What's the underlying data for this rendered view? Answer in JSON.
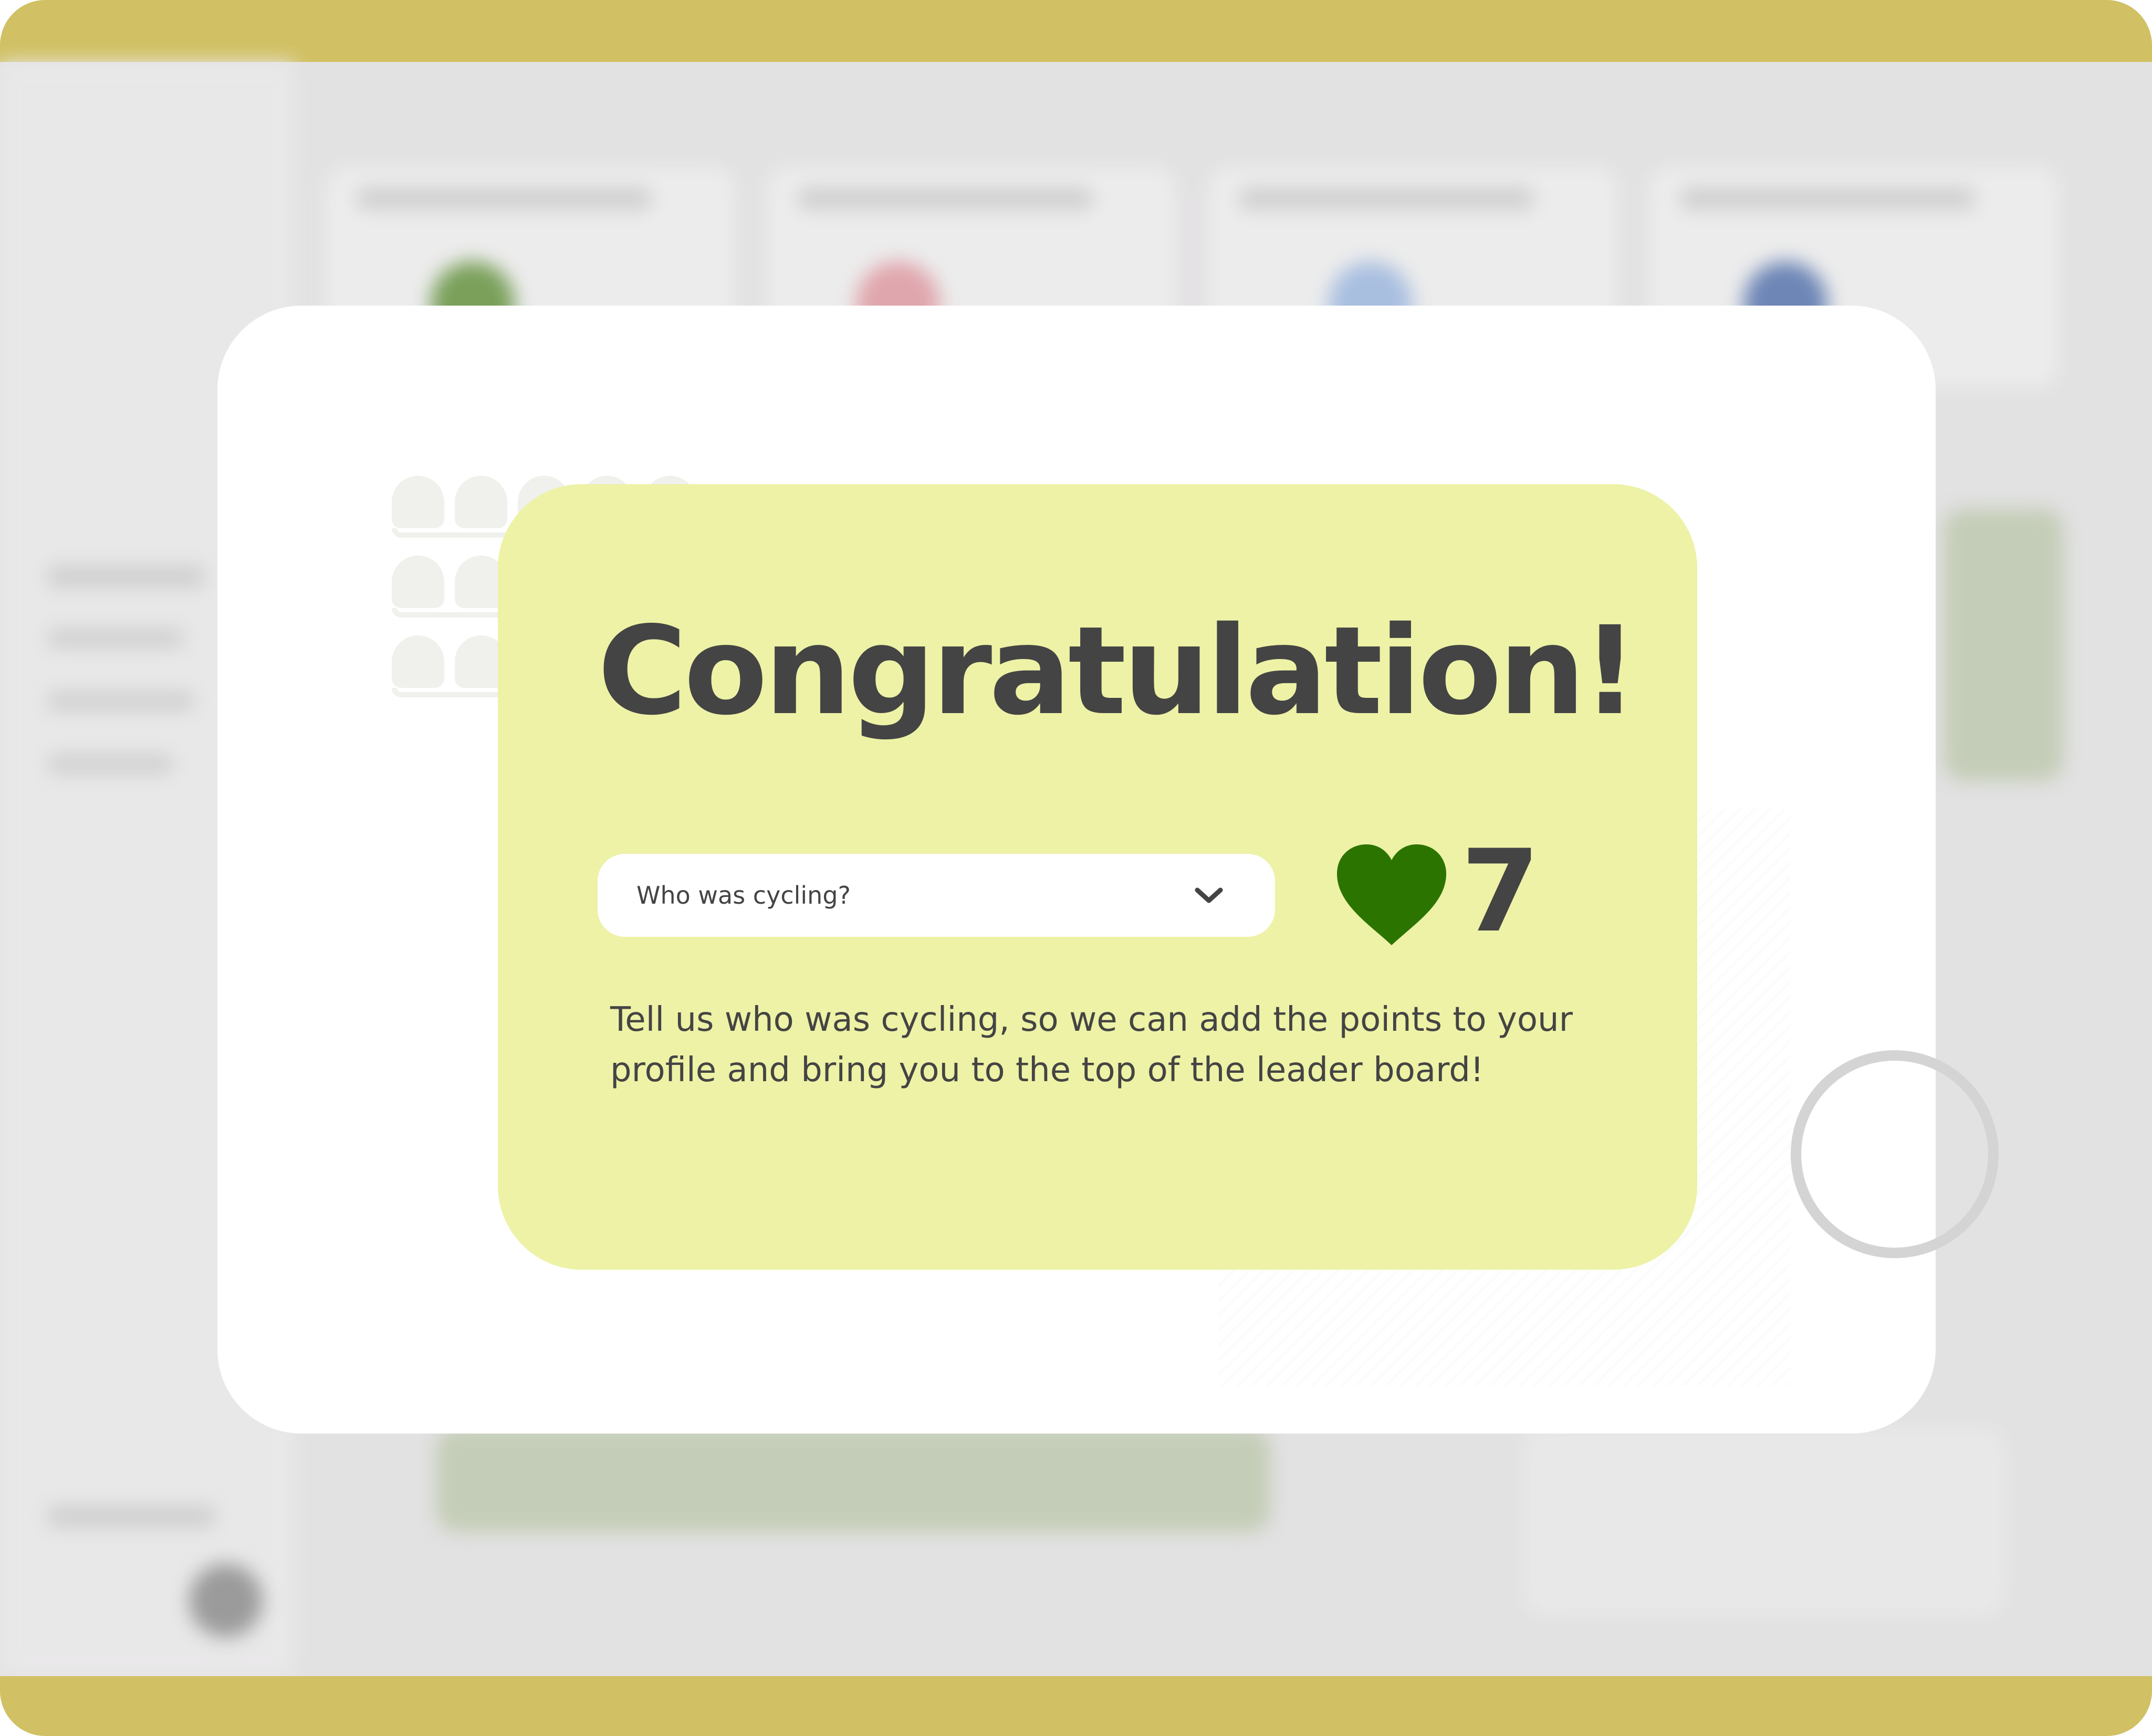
{
  "colors": {
    "frame_bar": "#d1c164",
    "card_background": "#edf2a6",
    "heart": "#2b7400",
    "text": "#444444"
  },
  "modal": {
    "title": "Congratulation!",
    "cyclist_select": {
      "placeholder": "Who was cycling?",
      "icon": "chevron-down-icon"
    },
    "score": {
      "icon": "heart-icon",
      "value": "7"
    },
    "description": "Tell us who was cycling, so we can add the points to your profile and bring you to the top of the leader board!"
  }
}
